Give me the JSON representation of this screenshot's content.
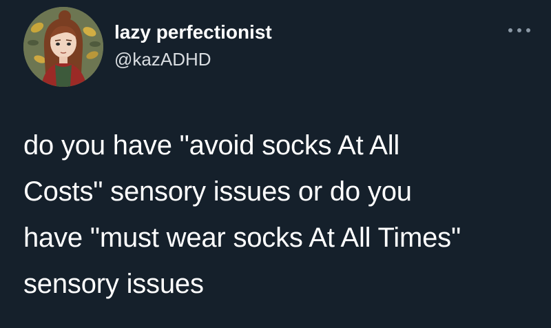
{
  "tweet": {
    "author": {
      "display_name": "lazy perfectionist",
      "handle": "@kazADHD",
      "avatar_icon": "illustrated-avatar"
    },
    "more_icon": "more-horizontal-icon",
    "text_lines": [
      "do you have \"avoid socks At All",
      "Costs\" sensory issues or do you",
      "have \"must wear socks At All Times\"",
      "sensory issues"
    ]
  },
  "colors": {
    "background": "#15202b",
    "text_primary": "#ffffff",
    "text_secondary": "#d9dde1",
    "icon_muted": "#8b98a5"
  }
}
